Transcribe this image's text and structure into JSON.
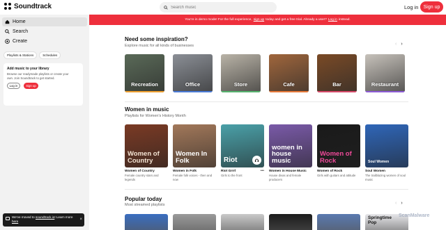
{
  "app": {
    "name": "Soundtrack",
    "search_placeholder": "Search music",
    "login_label": "Log in",
    "signup_label": "Sign up"
  },
  "sidebar": {
    "nav": [
      {
        "label": "Home",
        "icon": "home-icon",
        "active": true
      },
      {
        "label": "Search",
        "icon": "search-icon",
        "active": false
      },
      {
        "label": "Create",
        "icon": "plus-circle-icon",
        "active": false
      }
    ],
    "tabs": [
      "Playlists & Stations",
      "Schedules"
    ],
    "library_card": {
      "title": "Add music to your library",
      "description": "Browse our readymade playlists or create your own. Join Soundtrack to get started.",
      "login_label": "Log in",
      "signup_label": "Sign up"
    }
  },
  "banner": {
    "text_1": "You're in demo mode! For the full experience,",
    "link_1": "sign up",
    "text_2": "today and get a free trial. Already a user?",
    "link_2": "Log in",
    "text_3": "instead."
  },
  "inspiration": {
    "title": "Need some inspiration?",
    "subtitle": "Explore music for all kinds of businesses",
    "categories": [
      {
        "label": "Recreation",
        "bar": "#f0a030",
        "bg": "#5a6a58"
      },
      {
        "label": "Office",
        "bar": "#4a7bd8",
        "bg": "#8b8f96"
      },
      {
        "label": "Store",
        "bar": "#56b36f",
        "bg": "#b9b3a7"
      },
      {
        "label": "Cafe",
        "bar": "#e87a3a",
        "bg": "#a0663c"
      },
      {
        "label": "Bar",
        "bar": "#d84a6a",
        "bg": "#7a4a26"
      },
      {
        "label": "Restaurant",
        "bar": "#8d5bd6",
        "bg": "#c7c2bb"
      }
    ]
  },
  "women_in_music": {
    "title": "Women in music",
    "subtitle": "Playlists for Women's History Month",
    "playlists": [
      {
        "name": "Women of Country",
        "desc": "Female country stars and legends",
        "art_text": "Women of Country",
        "bg": "#7a3a24",
        "art_color": "#f3e3d3"
      },
      {
        "name": "Women in Folk",
        "desc": "Female folk voices - then and now",
        "art_text": "Women In Folk",
        "bg": "#a2785a",
        "art_color": "#ffffff"
      },
      {
        "name": "Riot Grrrl",
        "desc": "Girls to the front",
        "art_text": "Riot",
        "bg": "#4aa0a8",
        "art_color": "#ffffff"
      },
      {
        "name": "Women in House Music",
        "desc": "House divas and female producers",
        "art_text": "women in house music",
        "bg": "#7a5aa8",
        "art_color": "#ffffff"
      },
      {
        "name": "Women of Rock",
        "desc": "Girls with guitars and attitude",
        "art_text": "Women of Rock",
        "bg": "#1a1a1a",
        "art_color": "#f04a9a"
      },
      {
        "name": "Soul Women",
        "desc": "The trailblazing women of soul music",
        "art_text": "Soul Women",
        "bg": "#2f66b8",
        "art_color": "#ffffff"
      }
    ],
    "more_label": "•••"
  },
  "popular": {
    "title": "Popular today",
    "subtitle": "Most streamed playlists",
    "cards": [
      {
        "bg": "#3a6ec0",
        "label": ""
      },
      {
        "bg": "#9a9a9a",
        "label": ""
      },
      {
        "bg": "#c9c9c9",
        "label": ""
      },
      {
        "bg": "#1c1c1c",
        "label": ""
      },
      {
        "bg": "#5a7ab0",
        "label": ""
      },
      {
        "bg": "#e7e7ea",
        "label": "Springtime Pop"
      }
    ]
  },
  "toast": {
    "text_1": "We've moved to",
    "link": "soundtrack.io",
    "text_2": "! Learn more",
    "link_2": "here",
    "close": "×"
  },
  "watermark": "ScanMalware"
}
